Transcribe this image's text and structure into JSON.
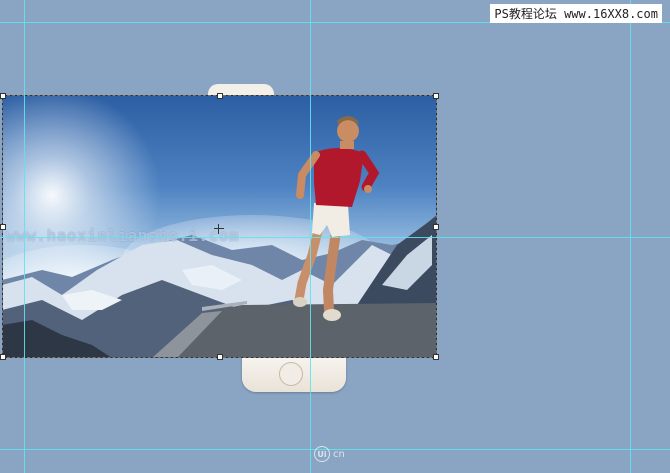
{
  "site_tag": "PS教程论坛 www.16XX8.com",
  "photo_watermark": "www.haoxinlianshe.i.com",
  "bottom_logo": {
    "mark": "Ui",
    "text": "cn"
  },
  "colors": {
    "canvas": "#89a5c3",
    "guide": "#5fe3ee"
  },
  "icons": [
    "center-point-icon",
    "home-button-icon"
  ]
}
